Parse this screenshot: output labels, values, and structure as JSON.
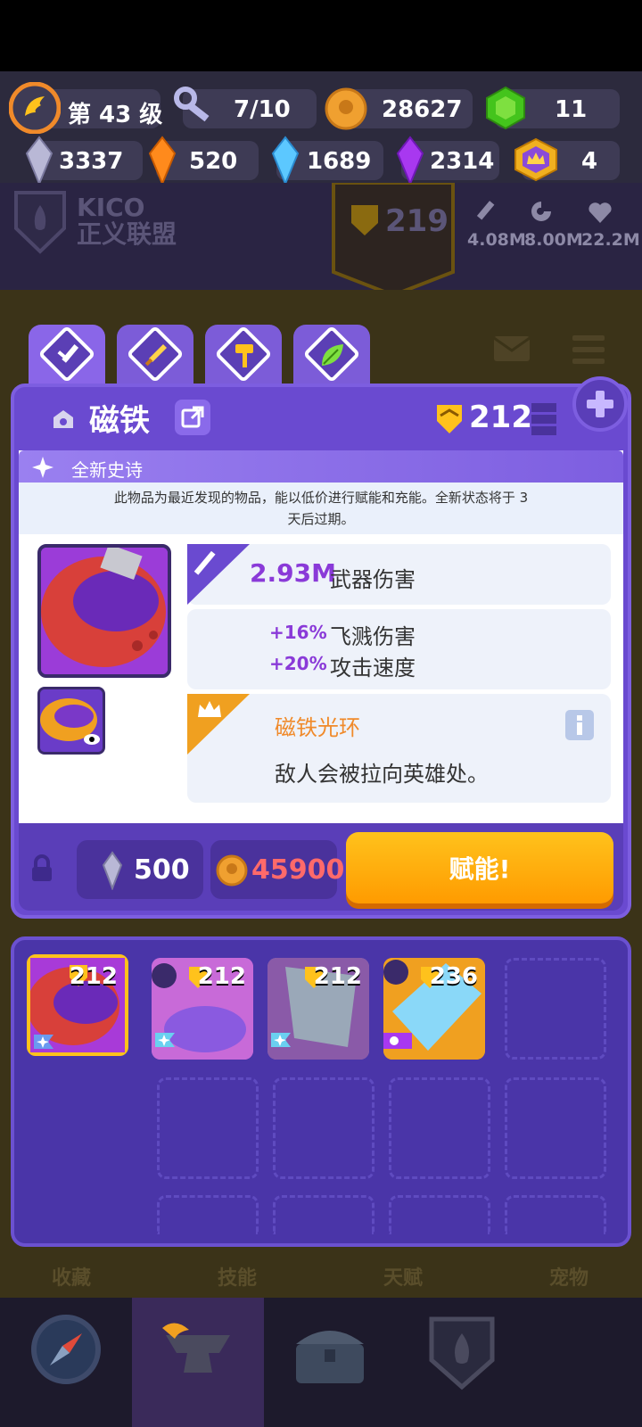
{
  "header": {
    "level_label": "第 43 级",
    "keys": "7/10",
    "gold": "28627",
    "gems": "11",
    "crystal_white": "3337",
    "crystal_orange": "520",
    "crystal_blue": "1689",
    "crystal_purple": "2314",
    "crown_tokens": "4"
  },
  "guild": {
    "name_line1": "KICO",
    "name_line2": "正义联盟",
    "power": "219",
    "stats": [
      "4.08M",
      "8.00M",
      "22.2M"
    ]
  },
  "tabs": [
    {
      "icon": "sword-icon"
    },
    {
      "icon": "dagger-icon"
    },
    {
      "icon": "hammer-icon"
    },
    {
      "icon": "leaf-icon"
    }
  ],
  "item": {
    "name": "磁铁",
    "level": "212",
    "epic_label": "全新史诗",
    "epic_desc_line1": "此物品为最近发现的物品，能以低价进行赋能和充能。全新状态将于 3",
    "epic_desc_line2": "天后过期。",
    "damage_value": "2.93M",
    "damage_label": "武器伤害",
    "bonus1_value": "+16%",
    "bonus1_label": "飞溅伤害",
    "bonus2_value": "+20%",
    "bonus2_label": "攻击速度",
    "ability_title": "磁铁光环",
    "ability_desc": "敌人会被拉向英雄处。"
  },
  "cost": {
    "crystal": "500",
    "gold": "45900"
  },
  "action": {
    "forge_label": "赋能!"
  },
  "inventory": [
    {
      "level": "212"
    },
    {
      "level": "212"
    },
    {
      "level": "212"
    },
    {
      "level": "236"
    }
  ],
  "nav_labels": [
    "收藏",
    "技能",
    "天赋",
    "宠物"
  ],
  "colors": {
    "panel": "#6a4ad0",
    "accent_purple": "#8a4dd8",
    "ability_orange": "#f08a2a",
    "forge_button": "#ffb000",
    "cost_gold_text": "#ff6a6a"
  }
}
